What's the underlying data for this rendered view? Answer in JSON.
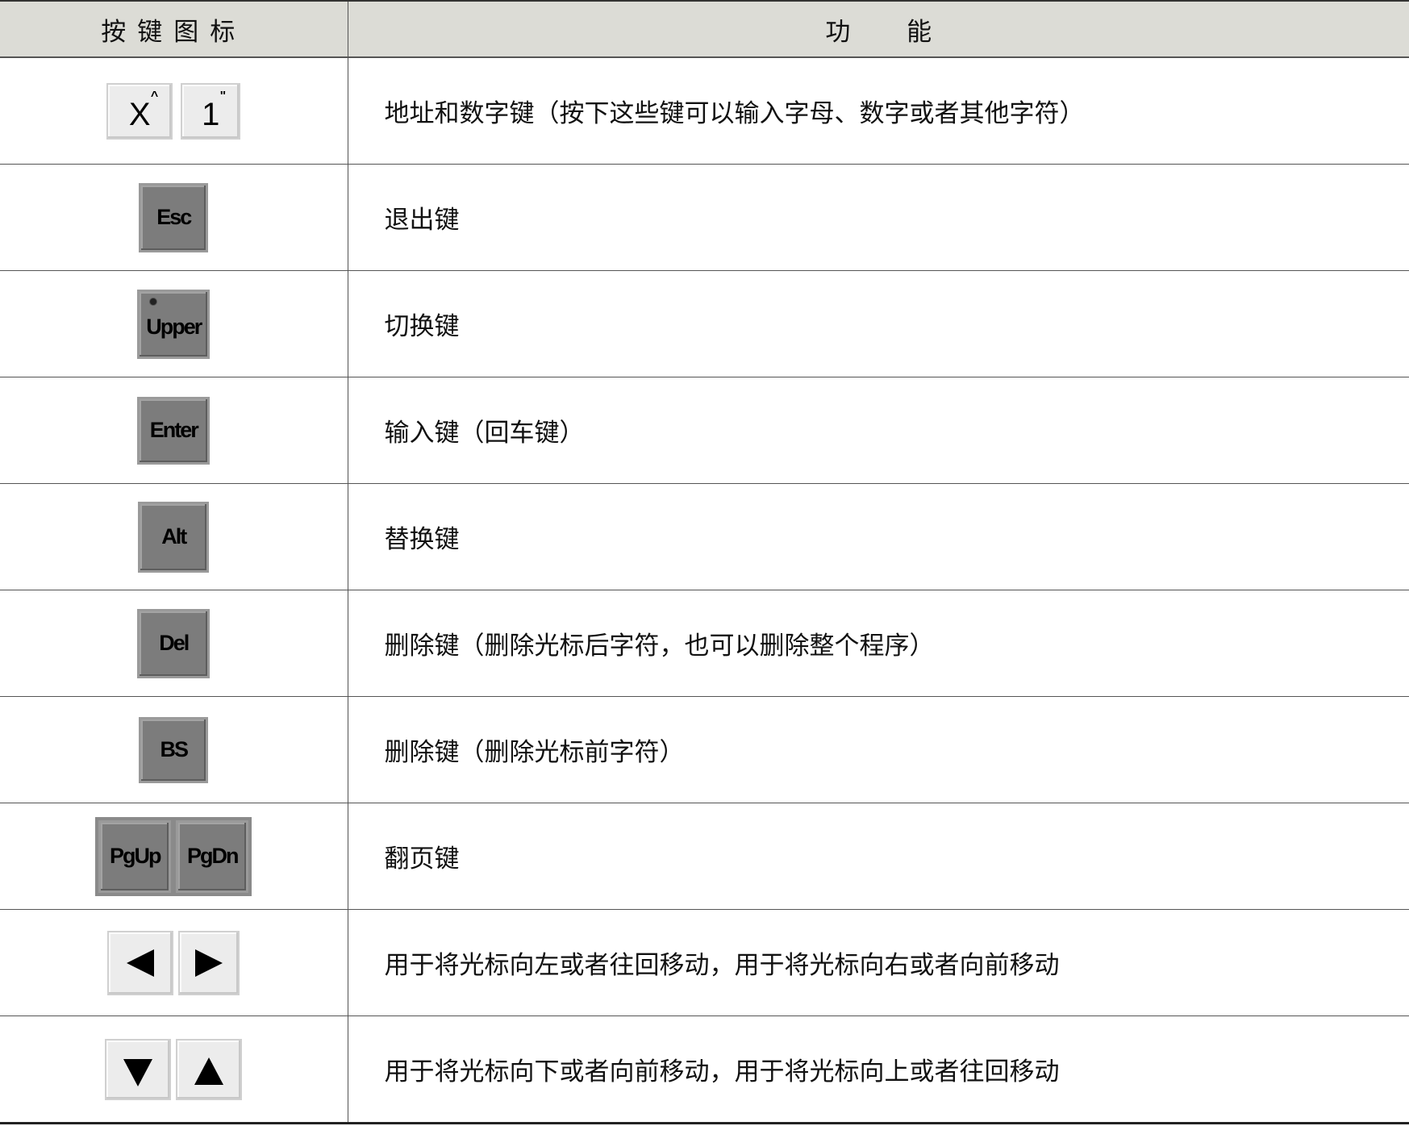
{
  "header": {
    "col1": "按键图标",
    "col2": "功 能"
  },
  "rows": [
    {
      "keys": [
        "X",
        "1"
      ],
      "key_secondary": [
        "^",
        "\""
      ],
      "desc": "地址和数字键（按下这些键可以输入字母、数字或者其他字符）"
    },
    {
      "keys": [
        "Esc"
      ],
      "desc": "退出键"
    },
    {
      "keys": [
        "Upper"
      ],
      "desc": "切换键"
    },
    {
      "keys": [
        "Enter"
      ],
      "desc": "输入键（回车键）"
    },
    {
      "keys": [
        "Alt"
      ],
      "desc": "替换键"
    },
    {
      "keys": [
        "Del"
      ],
      "desc": "删除键（删除光标后字符，也可以删除整个程序）"
    },
    {
      "keys": [
        "BS"
      ],
      "desc": "删除键（删除光标前字符）"
    },
    {
      "keys": [
        "PgUp",
        "PgDn"
      ],
      "desc": "翻页键"
    },
    {
      "icons": [
        "left-arrow-icon",
        "right-arrow-icon"
      ],
      "desc": "用于将光标向左或者往回移动，用于将光标向右或者向前移动"
    },
    {
      "icons": [
        "down-arrow-icon",
        "up-arrow-icon"
      ],
      "desc": "用于将光标向下或者向前移动，用于将光标向上或者往回移动"
    }
  ],
  "colors": {
    "header_bg": "#dcdcd6",
    "dark_key": "#7c7c7c",
    "light_key": "#ececec"
  }
}
